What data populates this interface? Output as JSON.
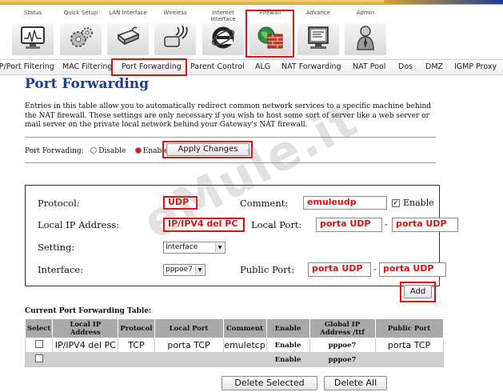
{
  "top_nav": [
    {
      "label": "Status",
      "icon": "status-monitor-icon"
    },
    {
      "label": "Quick Setup",
      "icon": "gears-icon"
    },
    {
      "label": "LAN Interface",
      "icon": "network-drive-icon"
    },
    {
      "label": "Wireless",
      "icon": "wireless-icon"
    },
    {
      "label": "Internet Interface",
      "icon": "internet-explorer-icon"
    },
    {
      "label": "Firewall",
      "icon": "firewall-globe-icon"
    },
    {
      "label": "Advance",
      "icon": "advance-monitor-icon"
    },
    {
      "label": "Admin",
      "icon": "admin-user-icon"
    }
  ],
  "sub_nav": [
    "IP/Port Filtering",
    "MAC Filtering",
    "Port Forwarding",
    "Parent Control",
    "ALG",
    "NAT Forwarding",
    "NAT Pool",
    "Dos",
    "DMZ",
    "IGMP Proxy"
  ],
  "page": {
    "title": "Port Forwarding",
    "description": "Entries in this table allow you to automatically redirect common network services to a specific machine behind the NAT firewall. These settings are only necessary if you wish to host some sort of server like a web server or mail server on the private local network behind your Gateway's NAT firewall.",
    "port_forwarding_label": "Port Forwading:",
    "disable_label": "Disable",
    "enable_label": "Enable",
    "apply_button": "Apply Changes"
  },
  "form": {
    "protocol_label": "Protocol:",
    "protocol_value": "UDP",
    "comment_label": "Comment:",
    "comment_value": "emuleudp",
    "enable_label": "Enable",
    "local_ip_label": "Local IP Address:",
    "local_ip_value": "IP/IPV4 del PC",
    "local_port_label": "Local Port:",
    "local_port_from": "porta UDP",
    "local_port_to": "porta UDP",
    "setting_label": "Setting:",
    "setting_value": "Interface",
    "interface_label": "Interface:",
    "interface_value": "pppoe7",
    "public_port_label": "Public Port:",
    "public_port_from": "porta UDP",
    "public_port_to": "porta UDP",
    "dash": "-",
    "add_button": "Add"
  },
  "table": {
    "title": "Current Port Forwarding Table:",
    "headers": [
      "Select",
      "Local IP Address",
      "Protocol",
      "Local Port",
      "Comment",
      "Enable",
      "Global IP Address /Itf",
      "Public Port"
    ],
    "rows": [
      [
        "",
        "IP/IPV4 del PC",
        "TCP",
        "porta TCP",
        "emuletcp",
        "Enable",
        "pppoe7",
        "porta TCP"
      ],
      [
        "",
        "",
        "",
        "",
        "",
        "Enable",
        "pppoe7",
        ""
      ]
    ]
  },
  "buttons": {
    "delete_selected": "Delete Selected",
    "delete_all": "Delete All"
  },
  "watermark": "eMule.it",
  "colors": {
    "accent_red": "#e01010",
    "title_blue": "#1a3d8f",
    "header_gray": "#a9a9a9"
  }
}
